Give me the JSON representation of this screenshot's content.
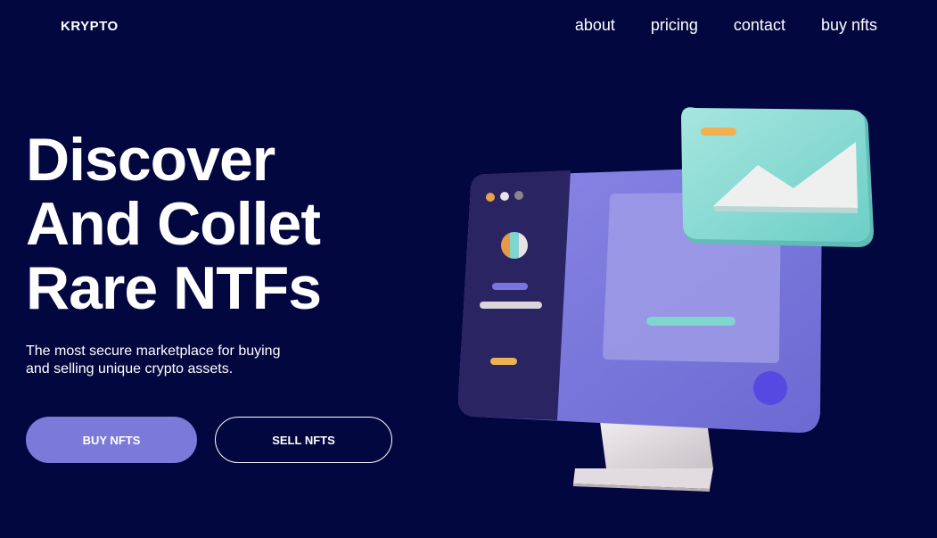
{
  "header": {
    "logo": "KRYPTO",
    "nav": [
      {
        "label": "about"
      },
      {
        "label": "pricing"
      },
      {
        "label": "contact"
      },
      {
        "label": "buy nfts"
      }
    ]
  },
  "hero": {
    "title_lines": [
      "Discover",
      "And Collet",
      "Rare NTFs"
    ],
    "subtitle_lines": [
      "The most secure marketplace for buying",
      "and selling unique crypto assets."
    ],
    "buy_label": "BUY NFTS",
    "sell_label": "SELL NFTS"
  },
  "illustration": {
    "name": "nft-computer-illustration",
    "colors": {
      "background": "#03073f",
      "screen": "#7b79dd",
      "sidebar": "#2b2460",
      "card": "#8f8de2",
      "image_tile": "#8fd9d3",
      "accent_teal": "#7fd6cf",
      "accent_orange": "#f0b050",
      "stand": "#e6e1e4",
      "dot": "#5a4fe0"
    }
  },
  "colors": {
    "background": "#03073f",
    "primary_button": "#7c7ad9",
    "text": "#ffffff"
  }
}
